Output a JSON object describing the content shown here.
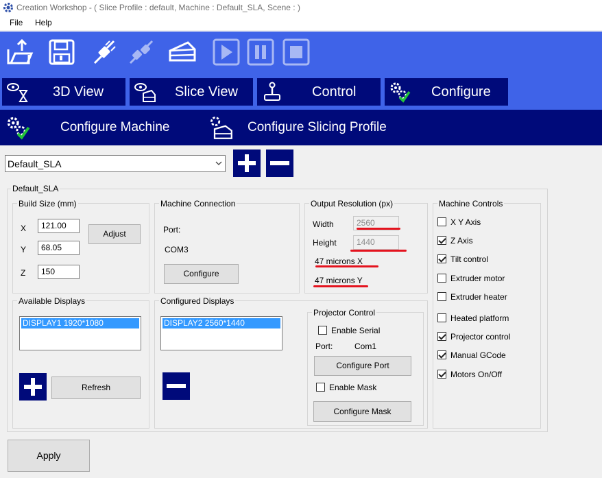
{
  "window": {
    "title": "Creation Workshop -   ( Slice Profile : default, Machine : Default_SLA, Scene : )"
  },
  "menu": {
    "file": "File",
    "help": "Help"
  },
  "toolbar": {
    "buttons": [
      "open-icon",
      "save-icon",
      "connect-icon",
      "disconnect-icon",
      "slice-icon",
      "play-icon",
      "pause-icon",
      "stop-icon"
    ]
  },
  "tabs": {
    "view3d": "3D View",
    "slice_view": "Slice View",
    "control": "Control",
    "configure": "Configure"
  },
  "subtabs": {
    "machine": "Configure Machine",
    "slicing": "Configure Slicing Profile"
  },
  "profile": {
    "selected": "Default_SLA"
  },
  "panel": {
    "title": "Default_SLA",
    "build_size": {
      "title": "Build Size (mm)",
      "x_label": "X",
      "x": "121.00",
      "y_label": "Y",
      "y": "68.05",
      "z_label": "Z",
      "z": "150",
      "adjust": "Adjust"
    },
    "machine_connection": {
      "title": "Machine Connection",
      "port_label": "Port:",
      "port": "COM3",
      "configure": "Configure"
    },
    "output_resolution": {
      "title": "Output Resolution (px)",
      "width_label": "Width",
      "width": "2560",
      "height_label": "Height",
      "height": "1440",
      "microns_x": "47 microns X",
      "microns_y": "47 microns Y"
    },
    "machine_controls": {
      "title": "Machine Controls",
      "items": [
        {
          "label": "X Y Axis",
          "checked": false
        },
        {
          "label": "Z Axis",
          "checked": true
        },
        {
          "label": "Tilt control",
          "checked": true
        },
        {
          "label": "Extruder motor",
          "checked": false
        },
        {
          "label": "Extruder heater",
          "checked": false
        },
        {
          "label": "Heated platform",
          "checked": false
        },
        {
          "label": "Projector control",
          "checked": true
        },
        {
          "label": "Manual GCode",
          "checked": true
        },
        {
          "label": "Motors On/Off",
          "checked": true
        }
      ]
    },
    "available_displays": {
      "title": "Available Displays",
      "items": [
        "DISPLAY1 1920*1080"
      ],
      "refresh": "Refresh"
    },
    "configured_displays": {
      "title": "Configured Displays",
      "items": [
        "DISPLAY2 2560*1440"
      ]
    },
    "projector_control": {
      "title": "Projector Control",
      "enable_serial": "Enable Serial",
      "port_label": "Port:",
      "port": "Com1",
      "configure_port": "Configure Port",
      "enable_mask": "Enable Mask",
      "configure_mask": "Configure Mask"
    }
  },
  "apply": "Apply",
  "colors": {
    "toolbar_blue": "#3f63e8",
    "navy": "#000a7a",
    "annotation_red": "#e4131e",
    "selection": "#3399ff"
  }
}
